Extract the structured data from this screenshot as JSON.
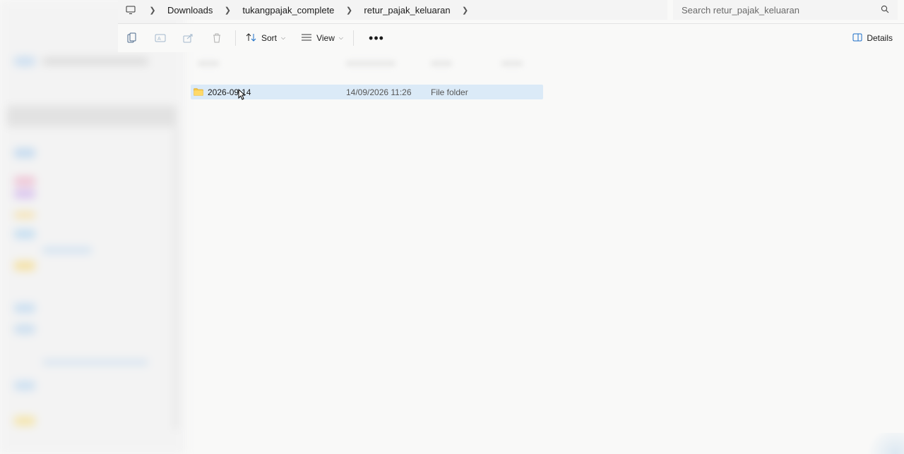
{
  "address_bar": {
    "pc_icon": "monitor-icon",
    "crumbs": [
      "Downloads",
      "tukangpajak_complete",
      "retur_pajak_keluaran"
    ]
  },
  "search": {
    "placeholder": "Search retur_pajak_keluaran",
    "icon": "search-icon"
  },
  "command_bar": {
    "icons": [
      "copy-icon",
      "rename-icon",
      "share-icon",
      "delete-icon"
    ],
    "sort_label": "Sort",
    "view_label": "View",
    "more_label": "•••",
    "details_label": "Details"
  },
  "files": [
    {
      "name": "2026-09-14",
      "date_modified": "14/09/2026 11:26",
      "type": "File folder",
      "selected": true
    }
  ],
  "colors": {
    "selected_row": "#dbeaf7",
    "folder": "#f5c542",
    "background": "#f9f9f8"
  }
}
